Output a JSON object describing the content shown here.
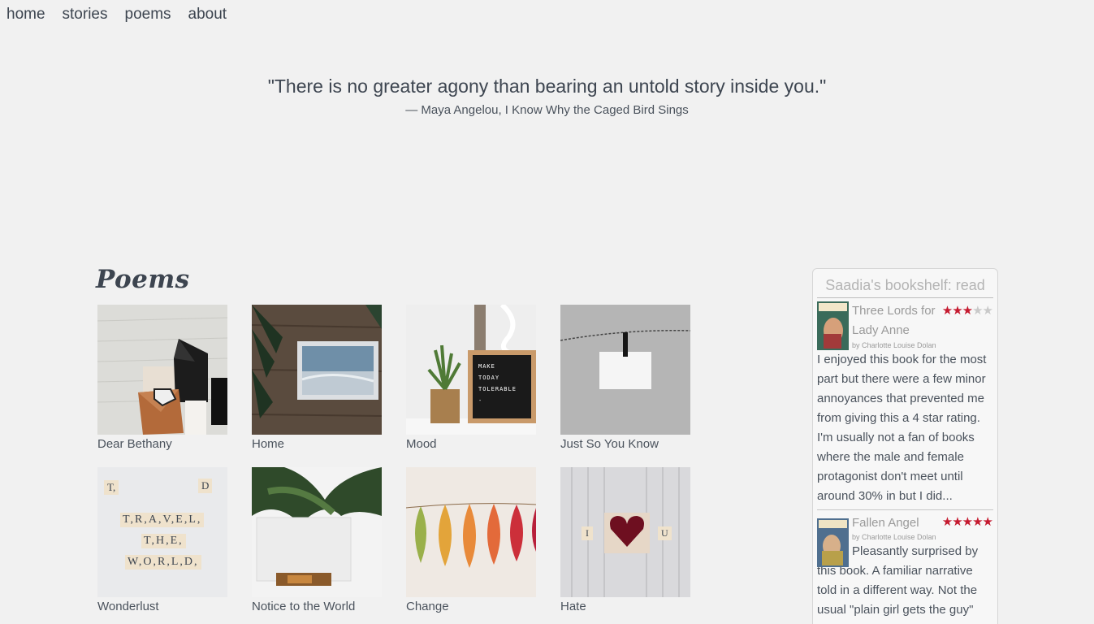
{
  "nav": {
    "items": [
      "home",
      "stories",
      "poems",
      "about"
    ]
  },
  "quote": {
    "text": "\"There is no greater agony than bearing an untold story inside you.\"",
    "cite": "— Maya Angelou, I Know Why the Caged Bird Sings"
  },
  "poems": {
    "heading": "Poems",
    "items": [
      {
        "caption": "Dear Bethany"
      },
      {
        "caption": "Home"
      },
      {
        "caption": "Mood"
      },
      {
        "caption": "Just So You Know"
      },
      {
        "caption": "Wonderlust"
      },
      {
        "caption": "Notice to the World"
      },
      {
        "caption": "Change"
      },
      {
        "caption": "Hate"
      }
    ],
    "image_text": {
      "mood_board": [
        "MAKE",
        "TODAY",
        "TOLERABLE",
        "-"
      ],
      "wonderlust_tiles": [
        "T,",
        "D",
        "T,R,A,V,E,L,",
        "T,H,E,",
        "W,O,R,L,D,"
      ],
      "hate_tiles": [
        "I",
        "U"
      ]
    }
  },
  "bookshelf": {
    "title": "Saadia's bookshelf: read",
    "books": [
      {
        "title": "Three Lords for Lady Anne",
        "author": "by Charlotte Louise Dolan",
        "rating": 3,
        "review": "I enjoyed this book for the most part but there were a few minor annoyances that prevented me from giving this a 4 star rating. I'm usually not a fan of books where the male and female protagonist don't meet until around 30% in but I did..."
      },
      {
        "title": "Fallen Angel",
        "author": "by Charlotte Louise Dolan",
        "rating": 5,
        "review": "Pleasantly surprised by this book. A familiar narrative told in a different way. Not the usual \"plain girl gets the guy\""
      }
    ]
  }
}
